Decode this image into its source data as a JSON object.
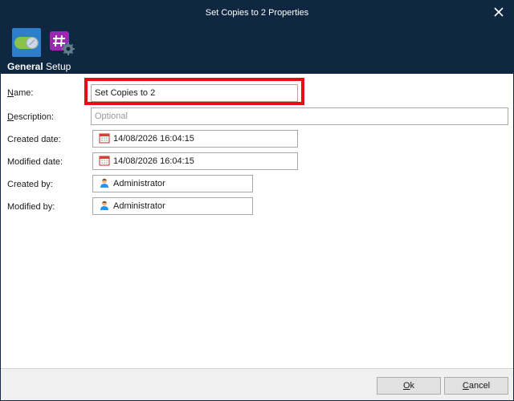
{
  "window": {
    "title": "Set Copies to 2 Properties"
  },
  "ribbon": {
    "tabs": [
      {
        "label": "General",
        "icon": "toggle-switch-icon",
        "selected": true
      },
      {
        "label": "Setup",
        "icon": "hash-gear-icon",
        "selected": false
      }
    ]
  },
  "form": {
    "name": {
      "label": "Name:",
      "value": "Set Copies to 2"
    },
    "description": {
      "label": "Description:",
      "value": "",
      "placeholder": "Optional"
    },
    "created_date": {
      "label": "Created date:",
      "value": "14/08/2026 16:04:15",
      "icon": "calendar-icon"
    },
    "modified_date": {
      "label": "Modified date:",
      "value": "14/08/2026 16:04:15",
      "icon": "calendar-icon"
    },
    "created_by": {
      "label": "Created by:",
      "value": "Administrator",
      "icon": "user-icon"
    },
    "modified_by": {
      "label": "Modified by:",
      "value": "Administrator",
      "icon": "user-icon"
    }
  },
  "footer": {
    "ok_label": "Ok",
    "cancel_label": "Cancel"
  },
  "colors": {
    "titlebar": "#0f2740",
    "highlight": "#e01016",
    "tab_selected": "#2d7fcc"
  }
}
